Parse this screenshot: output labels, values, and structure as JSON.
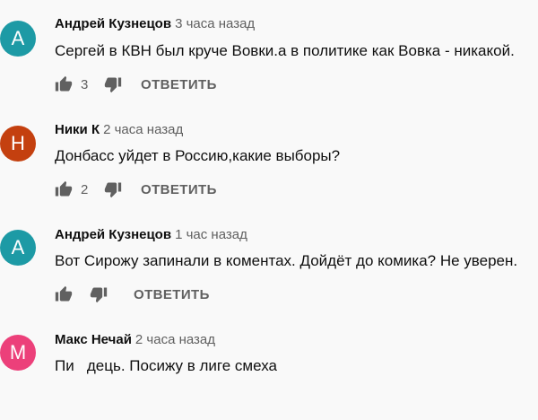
{
  "colors": {
    "background": "#f9f9f9",
    "secondary_text": "#606060"
  },
  "comments": [
    {
      "avatar_letter": "А",
      "avatar_color": "#1d9aa5",
      "author": "Андрей Кузнецов",
      "time": "3 часа назад",
      "text": "Сергей в КВН был круче Вовки.а в политике как Вовка - никакой.",
      "likes": "3",
      "reply_label": "ОТВЕТИТЬ"
    },
    {
      "avatar_letter": "Н",
      "avatar_color": "#c4400f",
      "author": "Ники К",
      "time": "2 часа назад",
      "text": "Донбасс уйдет в Россию,какие выборы?",
      "likes": "2",
      "reply_label": "ОТВЕТИТЬ"
    },
    {
      "avatar_letter": "А",
      "avatar_color": "#1d9aa5",
      "author": "Андрей Кузнецов",
      "time": "1 час назад",
      "text": "Вот Сирожу запинали в коментах. Дойдёт до комика? Не уверен.",
      "likes": "",
      "reply_label": "ОТВЕТИТЬ"
    },
    {
      "avatar_letter": "М",
      "avatar_color": "#ec407a",
      "author": "Макс Нечай",
      "time": "2 часа назад",
      "text": "Пи   дець. Посижу в лиге смеха",
      "likes": "",
      "reply_label": ""
    }
  ],
  "icons": {
    "like": "thumbs-up-icon",
    "dislike": "thumbs-down-icon"
  }
}
